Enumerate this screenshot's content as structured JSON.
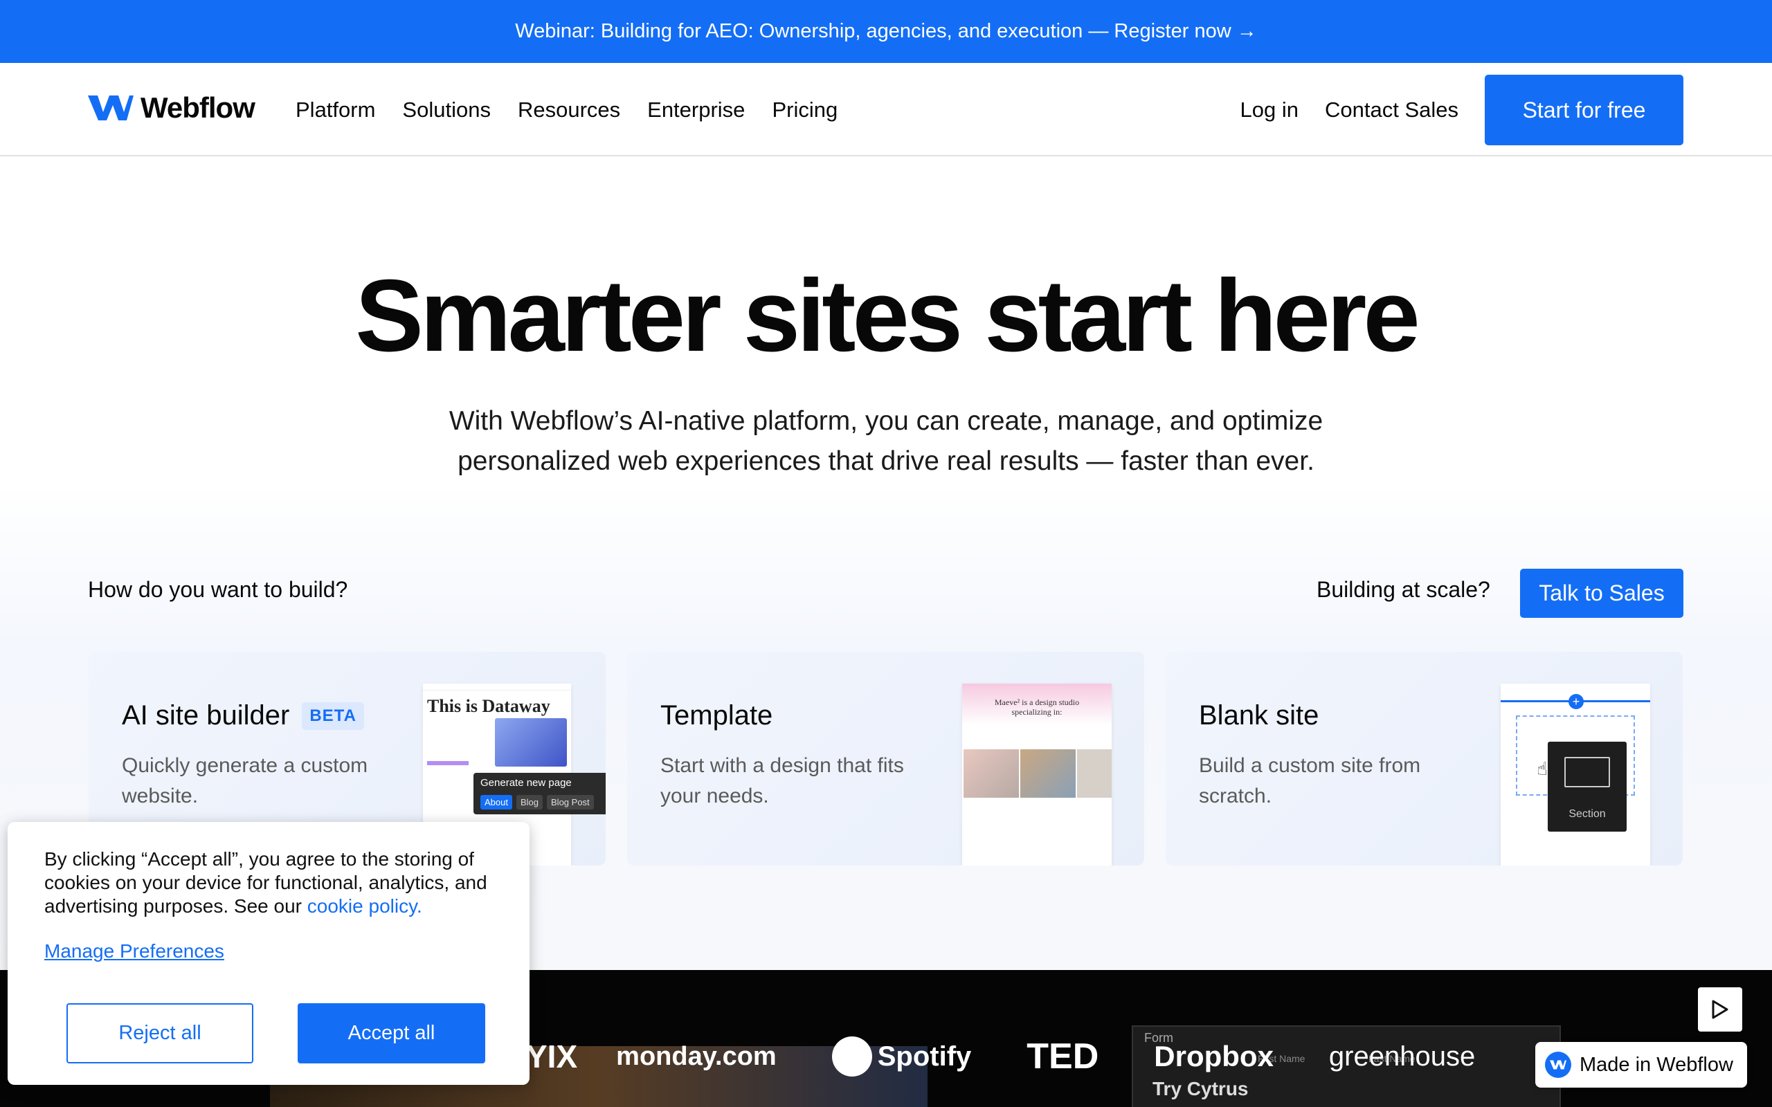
{
  "banner": {
    "text": "Webinar: Building for AEO: Ownership, agencies, and execution — Register now →"
  },
  "nav": {
    "logo": "Webflow",
    "links": [
      "Platform",
      "Solutions",
      "Resources",
      "Enterprise",
      "Pricing"
    ],
    "login": "Log in",
    "contact": "Contact Sales",
    "cta": "Start for free"
  },
  "hero": {
    "title": "Smarter sites start here",
    "subtitle_line1": "With Webflow’s AI-native platform, you can create, manage, and optimize",
    "subtitle_line2": "personalized web experiences that drive real results — faster than ever."
  },
  "build": {
    "question": "How do you want to build?",
    "scale_question": "Building at scale?",
    "talk_button": "Talk to Sales"
  },
  "cards": [
    {
      "title": "AI site builder",
      "badge": "BETA",
      "desc": "Quickly generate a custom website.",
      "preview_heading": "This is Dataway",
      "popup_title": "Generate new page",
      "chips": [
        "About",
        "Blog",
        "Blog Post"
      ]
    },
    {
      "title": "Template",
      "desc": "Start with a design that fits your needs.",
      "preview_heading": "Maeve² is a design studio specializing in:"
    },
    {
      "title": "Blank site",
      "desc": "Build a custom site from scratch.",
      "preview_label": "Section"
    }
  ],
  "logos": [
    "YIX",
    "monday.com",
    "Spotify",
    "TED",
    "Dropbox",
    "greenhouse"
  ],
  "strip_form": {
    "label": "Form",
    "heading": "Try Cytrus",
    "first_name": "First Name",
    "last_name": "Last Name"
  },
  "badge": {
    "text": "Made in Webflow"
  },
  "cookie": {
    "text": "By clicking “Accept all”, you agree to the storing of cookies on your device for functional, analytics, and advertising purposes. See our",
    "link": "cookie policy.",
    "manage": "Manage Preferences",
    "reject": "Reject all",
    "accept": "Accept all"
  },
  "colors": {
    "brand": "#146ef5",
    "text": "#080808",
    "dark": "#050505"
  },
  "icons": [
    "webflow-logo-icon",
    "play-icon",
    "plus-icon",
    "hand-cursor-icon",
    "info-icon"
  ]
}
